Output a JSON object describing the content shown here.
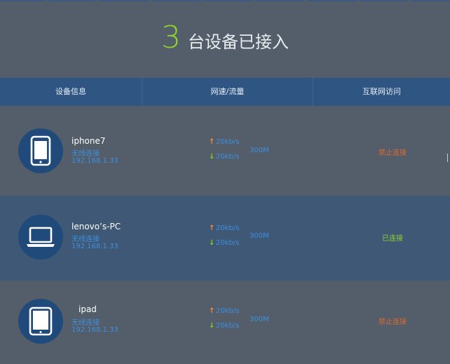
{
  "header": {
    "count": "3",
    "count_color": "#8fd52a",
    "title_text": "台设备已接入"
  },
  "table": {
    "columns": [
      "设备信息",
      "网速/流量",
      "互联网访问"
    ],
    "header_color": "#2f5683"
  },
  "devices": [
    {
      "name": "iphone7",
      "icon": "smartphone-icon",
      "connection": "无线连接",
      "ip": "192.168.1.33",
      "upload": "20kb/s",
      "download": "20kb/s",
      "traffic": "300M",
      "access": "禁止连接",
      "access_color": "#e06a2c"
    },
    {
      "name": "lenovo’s-PC",
      "icon": "laptop-icon",
      "connection": "无线连接",
      "ip": "192.168.1.33",
      "upload": "20kb/s",
      "download": "20kb/s",
      "traffic": "300M",
      "access": "已连接",
      "access_color": "#8fd52a"
    },
    {
      "name": "ipad",
      "icon": "tablet-icon",
      "connection": "无线连接",
      "ip": "192.168.1.33",
      "upload": "20kb/s",
      "download": "20kb/s",
      "traffic": "300M",
      "access": "禁止连接",
      "access_color": "#e06a2c"
    }
  ],
  "colors": {
    "background": "#535e6a",
    "alt_row": "#3f5876",
    "link_blue": "#3d8fe0",
    "upload_arrow": "#ff8a3c",
    "download_arrow": "#7fd321"
  }
}
